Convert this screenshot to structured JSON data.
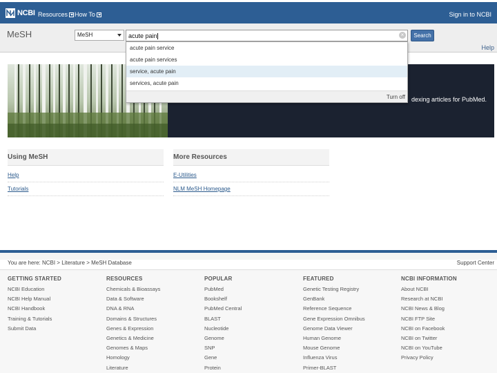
{
  "header": {
    "logo_text": "NCBI",
    "menu": [
      {
        "label": "Resources"
      },
      {
        "label": "How To"
      }
    ],
    "signin": "Sign in to NCBI"
  },
  "search": {
    "db_title": "MeSH",
    "db_select": "MeSH",
    "query": "acute pain",
    "button": "Search",
    "help": "Help"
  },
  "autocomplete": {
    "items": [
      "acute pain service",
      "acute pain services",
      "service, acute pain",
      "services, acute pain"
    ],
    "highlighted_index": 2,
    "footer": "Turn off"
  },
  "hero": {
    "text": "dexing articles for PubMed."
  },
  "using": {
    "title": "Using MeSH",
    "links": [
      "Help",
      "Tutorials"
    ]
  },
  "more": {
    "title": "More Resources",
    "links": [
      "E-Utilities",
      "NLM MeSH Homepage"
    ]
  },
  "footer": {
    "breadcrumb": "You are here: NCBI > Literature > MeSH Database",
    "support": "Support Center",
    "columns": [
      {
        "title": "GETTING STARTED",
        "links": [
          "NCBI Education",
          "NCBI Help Manual",
          "NCBI Handbook",
          "Training & Tutorials",
          "Submit Data"
        ]
      },
      {
        "title": "RESOURCES",
        "links": [
          "Chemicals & Bioassays",
          "Data & Software",
          "DNA & RNA",
          "Domains & Structures",
          "Genes & Expression",
          "Genetics & Medicine",
          "Genomes & Maps",
          "Homology",
          "Literature"
        ]
      },
      {
        "title": "POPULAR",
        "links": [
          "PubMed",
          "Bookshelf",
          "PubMed Central",
          "BLAST",
          "Nucleotide",
          "Genome",
          "SNP",
          "Gene",
          "Protein"
        ]
      },
      {
        "title": "FEATURED",
        "links": [
          "Genetic Testing Registry",
          "GenBank",
          "Reference Sequence",
          "Gene Expression Omnibus",
          "Genome Data Viewer",
          "Human Genome",
          "Mouse Genome",
          "Influenza Virus",
          "Primer-BLAST"
        ]
      },
      {
        "title": "NCBI INFORMATION",
        "links": [
          "About NCBI",
          "Research at NCBI",
          "NCBI News & Blog",
          "NCBI FTP Site",
          "NCBI on Facebook",
          "NCBI on Twitter",
          "NCBI on YouTube",
          "Privacy Policy"
        ]
      }
    ]
  },
  "colors": {
    "header_blue": "#2d5e94",
    "button_blue": "#4471a8",
    "link_blue": "#2b5a8c",
    "hero_dark": "#1b2230",
    "autocomplete_highlight": "#e2eef6"
  }
}
